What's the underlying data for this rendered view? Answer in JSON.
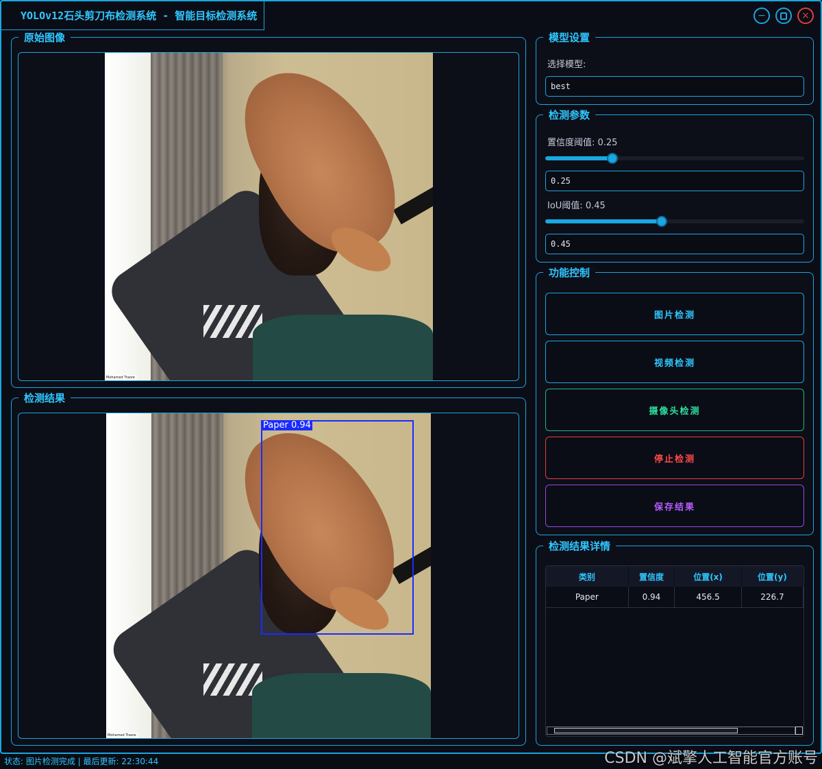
{
  "window": {
    "title": "YOLOv12石头剪刀布检测系统 - 智能目标检测系统",
    "controls": [
      "minimize-icon",
      "maximize-icon",
      "close-icon"
    ]
  },
  "original_panel": {
    "title": "原始图像",
    "image_caption": "Mohamed Traore"
  },
  "result_panel": {
    "title": "检测结果",
    "image_caption": "Mohamed Traore",
    "detection_label": "Paper 0.94"
  },
  "model_settings": {
    "title": "模型设置",
    "select_label": "选择模型:",
    "model_value": "best"
  },
  "params": {
    "title": "检测参数",
    "conf_label": "置信度阈值: 0.25",
    "conf_value": "0.25",
    "conf_level": 0.25,
    "iou_label": "IoU阈值: 0.45",
    "iou_value": "0.45",
    "iou_level": 0.45
  },
  "controls": {
    "title": "功能控制",
    "image_detect": "图片检测",
    "video_detect": "视频检测",
    "camera_detect": "摄像头检测",
    "stop_detect": "停止检测",
    "save_result": "保存结果",
    "colors": {
      "image": "#2fc7ff",
      "video": "#2fc7ff",
      "camera": "#2ee0a0",
      "stop": "#ff4a4a",
      "save": "#b65cff"
    }
  },
  "details": {
    "title": "检测结果详情",
    "columns": [
      "类别",
      "置信度",
      "位置(x)",
      "位置(y)"
    ],
    "rows": [
      [
        "Paper",
        "0.94",
        "456.5",
        "226.7"
      ]
    ]
  },
  "status": {
    "text": "状态: 图片检测完成 | 最后更新: 22:30:44"
  },
  "watermark": "CSDN @斌擎人工智能官方账号"
}
